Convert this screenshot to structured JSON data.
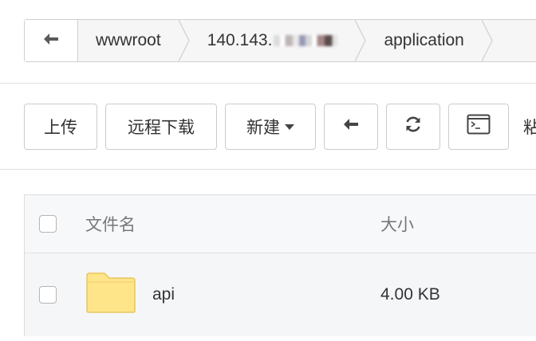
{
  "breadcrumb": {
    "back_icon": "arrow-left-icon",
    "items": [
      {
        "label": "wwwroot"
      },
      {
        "label": "140.143."
      },
      {
        "label": "application"
      }
    ]
  },
  "toolbar": {
    "upload_label": "上传",
    "remote_download_label": "远程下载",
    "new_label": "新建",
    "back_icon": "arrow-left-icon",
    "refresh_icon": "refresh-icon",
    "terminal_icon": "terminal-icon",
    "trailing_text": "粘"
  },
  "table": {
    "columns": {
      "name": "文件名",
      "size": "大小"
    },
    "rows": [
      {
        "name": "api",
        "size": "4.00 KB",
        "icon": "folder-icon"
      }
    ]
  },
  "colors": {
    "folder": "#ffe58a",
    "folder_border": "#e8c55d",
    "border": "#cccccc"
  }
}
